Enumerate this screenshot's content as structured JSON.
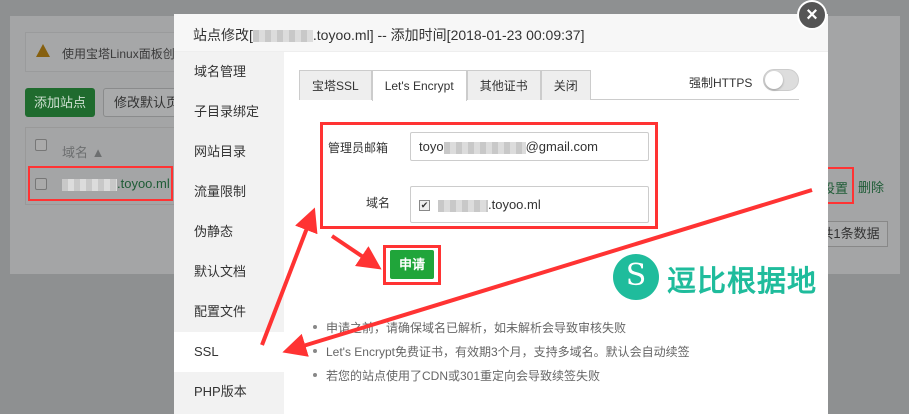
{
  "background": {
    "alert_text": "使用宝塔Linux面板创",
    "add_site_label": "添加站点",
    "modify_default_label": "修改默认页",
    "column_domain": "域名",
    "site_domain_suffix": ".toyoo.ml",
    "settings_label": "设置",
    "delete_label": "删除",
    "pager_text": "共1条数据"
  },
  "modal": {
    "title_prefix": "站点修改[",
    "title_suffix": ".toyoo.ml] -- 添加时间[2018-01-23 00:09:37]",
    "close_icon": "×",
    "sidebar": [
      {
        "label": "域名管理"
      },
      {
        "label": "子目录绑定"
      },
      {
        "label": "网站目录"
      },
      {
        "label": "流量限制"
      },
      {
        "label": "伪静态"
      },
      {
        "label": "默认文档"
      },
      {
        "label": "配置文件"
      },
      {
        "label": "SSL"
      },
      {
        "label": "PHP版本"
      }
    ],
    "tabs": [
      {
        "label": "宝塔SSL"
      },
      {
        "label": "Let's Encrypt"
      },
      {
        "label": "其他证书"
      },
      {
        "label": "关闭"
      }
    ],
    "force_https_label": "强制HTTPS",
    "force_https_on": false,
    "email_label": "管理员邮箱",
    "email_prefix": "toyo",
    "email_suffix": "@gmail.com",
    "domain_label": "域名",
    "domain_checked": true,
    "domain_suffix": ".toyoo.ml",
    "apply_label": "申请",
    "tips": [
      "申请之前，请确保域名已解析，如未解析会导致审核失败",
      "Let's Encrypt免费证书，有效期3个月，支持多域名。默认会自动续签",
      "若您的站点使用了CDN或301重定向会导致续签失败"
    ]
  },
  "watermark": {
    "text": "逗比根据地"
  },
  "colors": {
    "accent": "#20a53a",
    "annotation": "#ff3333",
    "logo": "#1fbc9c"
  }
}
